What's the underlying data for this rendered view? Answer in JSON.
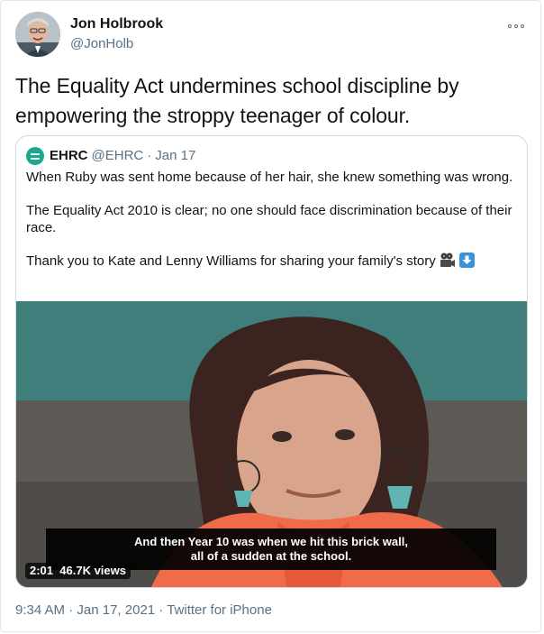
{
  "author": {
    "name": "Jon Holbrook",
    "handle": "@JonHolb",
    "avatar_icon": "profile-photo"
  },
  "more_icon": "more-options-icon",
  "tweet": {
    "text": "The Equality Act undermines school discipline by empowering the stroppy teenager of colour."
  },
  "quoted_tweet": {
    "name": "EHRC",
    "handle": "@EHRC",
    "separator": "·",
    "date": "Jan 17",
    "logo_color": "#1aa88f",
    "paragraphs": [
      "When Ruby was sent home because of her hair, she knew something was wrong.",
      "The Equality Act 2010 is clear; no one should face discrimination because of their race.",
      "Thank you to Kate and Lenny Williams for sharing your family's story"
    ],
    "emojis": [
      "movie-camera-icon",
      "down-arrow-icon"
    ],
    "video": {
      "subtitle_line1": "And then Year 10 was when we hit this brick wall,",
      "subtitle_line2": "all of a sudden at the school.",
      "duration": "2:01",
      "views": "46.7K views"
    }
  },
  "meta": {
    "time": "9:34 AM",
    "separator": " · ",
    "date": "Jan 17, 2021",
    "source": "Twitter for iPhone"
  }
}
